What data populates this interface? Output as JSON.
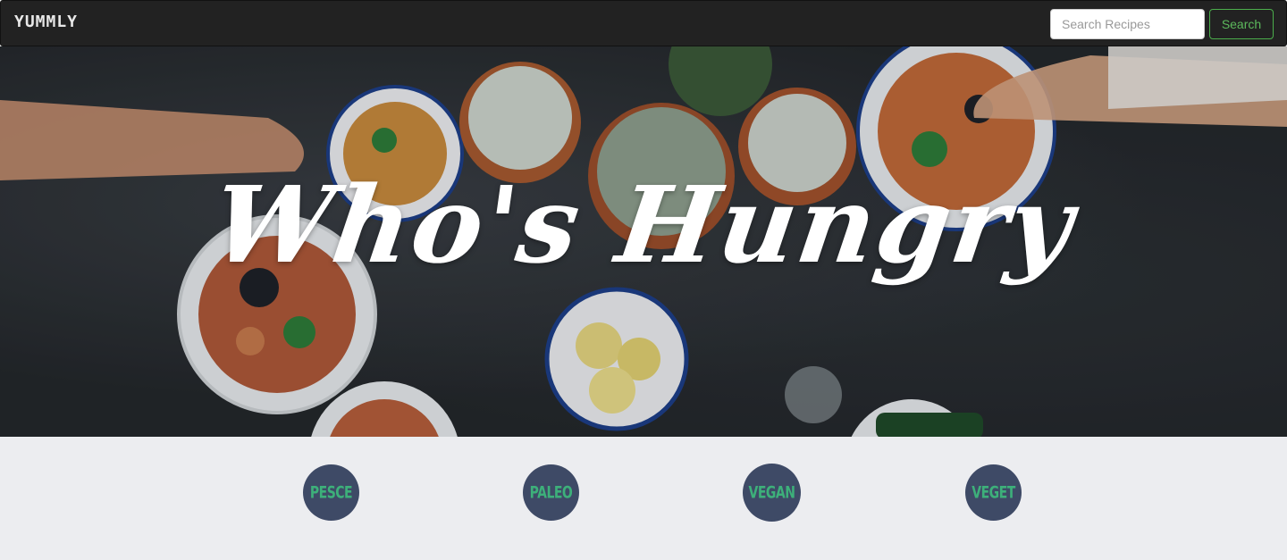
{
  "navbar": {
    "brand": "YUMMLY",
    "search_placeholder": "Search Recipes",
    "search_value": "",
    "search_button": "Search"
  },
  "hero": {
    "title": "Who's Hungry"
  },
  "diets": [
    {
      "label": "PESCE"
    },
    {
      "label": "PALEO"
    },
    {
      "label": "VEGAN"
    },
    {
      "label": "VEGET"
    }
  ],
  "colors": {
    "navbar_bg": "#222222",
    "accent_green": "#5cb85c",
    "diet_circle": "#3e4a66",
    "diet_text": "#3db07a",
    "diets_bg": "#ecedf0"
  }
}
